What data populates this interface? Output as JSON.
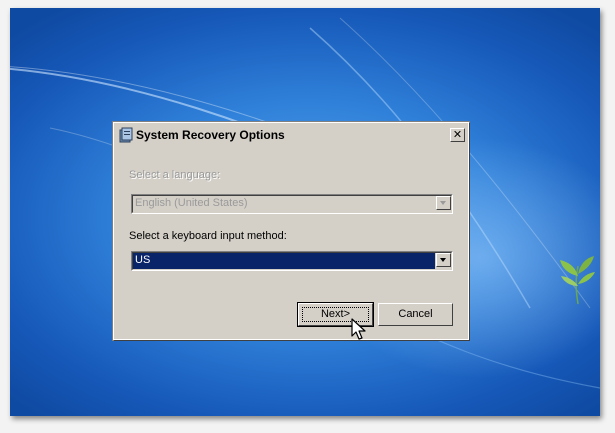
{
  "dialog": {
    "title": "System Recovery Options",
    "close_glyph": "✕"
  },
  "language": {
    "label": "Select a language:",
    "value": "English (United States)",
    "enabled": false
  },
  "keyboard": {
    "label": "Select a keyboard input method:",
    "value": "US",
    "enabled": true
  },
  "buttons": {
    "next_label": "Next>",
    "cancel_label": "Cancel"
  },
  "icons": {
    "title": "recovery-app-icon",
    "close": "close-icon",
    "dropdown": "chevron-down-icon",
    "cursor": "mouse-pointer-icon",
    "branding": "windows-leaf-icon"
  },
  "colors": {
    "selection": "#0a246a",
    "dialog_face": "#d4d0c8",
    "desktop": "#2f80d9"
  }
}
